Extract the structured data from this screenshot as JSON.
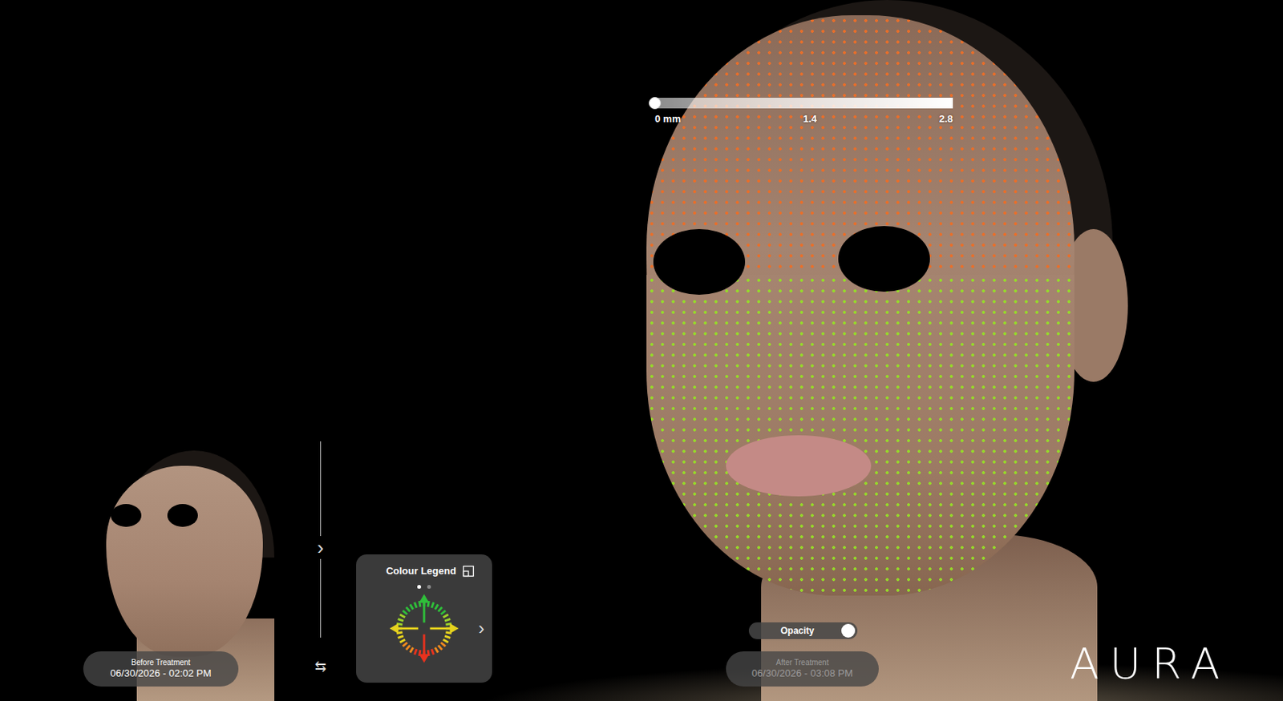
{
  "scale": {
    "ticks": [
      "0 mm",
      "1.4",
      "2.8"
    ],
    "level": 0
  },
  "before": {
    "label": "Before Treatment",
    "time": "06/30/2026 - 02:02 PM"
  },
  "after": {
    "label": "After Treatment",
    "time": "06/30/2026 - 03:08 PM",
    "disabled": true
  },
  "nav": {
    "next": "›",
    "swap": "⇆"
  },
  "legend": {
    "title": "Colour Legend",
    "pages": [
      {
        "selected": true
      },
      {
        "selected": false
      }
    ],
    "next": "›"
  },
  "opacity": {
    "label": "Opacity",
    "on": true
  },
  "logo": "AURA"
}
